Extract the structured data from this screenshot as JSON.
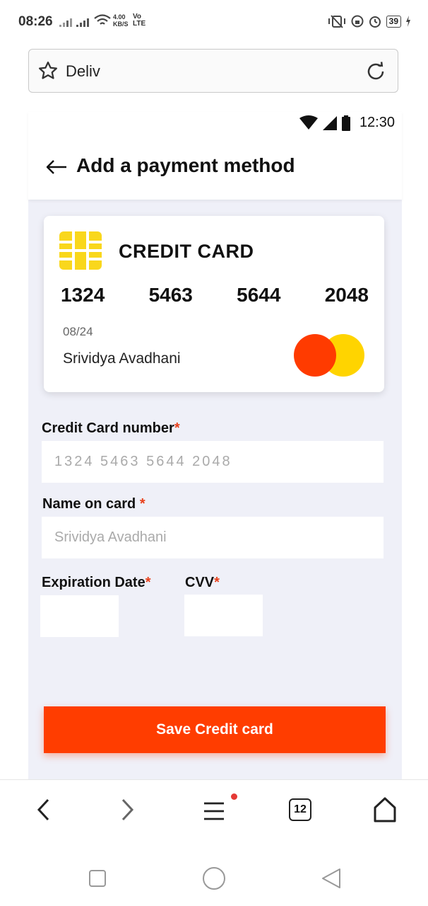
{
  "status_bar": {
    "time": "08:26",
    "net_speed": "4.00\nKB/S",
    "net_type": "Vo\nLTE",
    "battery": "39"
  },
  "browser": {
    "url_text": "Deliv",
    "tab_count": "12"
  },
  "app": {
    "inner_time": "12:30",
    "title": "Add a payment method",
    "card": {
      "type": "CREDIT CARD",
      "digits": [
        "1324",
        "5463",
        "5644",
        "2048"
      ],
      "expiry": "08/24",
      "holder": "Srividya Avadhani"
    },
    "form": {
      "card_number_label": "Credit Card number",
      "card_number_placeholder": "1324 5463 5644 2048",
      "name_label": "Name on card ",
      "name_placeholder": "Srividya Avadhani",
      "expiry_label": "Expiration Date",
      "cvv_label": "CVV",
      "required_mark": "*"
    },
    "save_label": "Save Credit card"
  },
  "colors": {
    "accent": "#ff3d00",
    "chip": "#f9d71c",
    "background": "#eff0f8"
  }
}
